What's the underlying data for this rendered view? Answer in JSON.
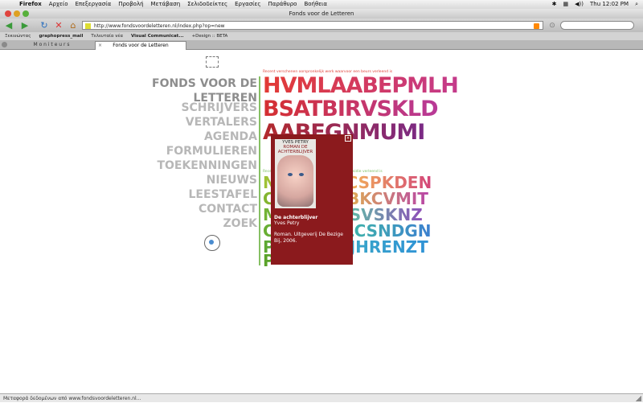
{
  "menubar": {
    "items": [
      "Firefox",
      "Αρχείο",
      "Επεξεργασία",
      "Προβολή",
      "Μετάβαση",
      "Σελιδοδείκτες",
      "Εργασίες",
      "Παράθυρο",
      "Βοήθεια"
    ],
    "clock": "Thu 12:02 PM"
  },
  "window": {
    "title": "Fonds voor de Letteren"
  },
  "navbar": {
    "url": "http://www.fondsvoordeletteren.nl/index.php?op=new"
  },
  "bookmarks": [
    "Ξεκινώντας",
    "graphopress_mail",
    "Τελευταία νέα",
    "Visual Communicat...",
    "+Design :: BETA"
  ],
  "tabs": [
    {
      "label": "M o n i t e u r s"
    },
    {
      "label": "Fonds voor de Letteren"
    }
  ],
  "sidenav": {
    "title1": "FONDS VOOR DE",
    "title2": "LETTEREN",
    "items": [
      "SCHRIJVERS",
      "VERTALERS",
      "AGENDA",
      "FORMULIEREN",
      "TOEKENNINGEN",
      "NIEUWS",
      "LEESTAFEL",
      "CONTACT",
      "ZOEK"
    ]
  },
  "grid": {
    "caption1": "Recent verschenen oorspronkelijk werk waarvoor een beurs verleend is",
    "caption2": "Recent verschenen vertalingen waarvoor een subsidie verleend is",
    "row1": "HVMLAABEPMLH",
    "row2": "BSATBIRVSKLD",
    "row3": "AABFGNMUMI",
    "lower": [
      "N      NECCSPKDEN",
      "C      VGDBKCVMIT",
      "M      CCNSVSKNZ",
      "C      VFBLCSNDGN",
      "P      JEVCJHRENZT",
      "P"
    ]
  },
  "popup": {
    "cover_author": "YVES PETRY",
    "cover_title": "ROMAN DE ACHTERBLIJVER",
    "title": "De achterblijver",
    "author": "Yves Petry",
    "description": "Roman. Uitgeverij De Bezige Bij, 2006."
  },
  "statusbar": {
    "text": "Μεταφορά δεδομένων από www.fondsvoordeletteren.nl..."
  },
  "colors": {
    "popup_bg": "#8b1a1d",
    "nav_gray": "#b7b7b7",
    "divider_green": "#86c064",
    "caption_red": "#e0453d"
  }
}
